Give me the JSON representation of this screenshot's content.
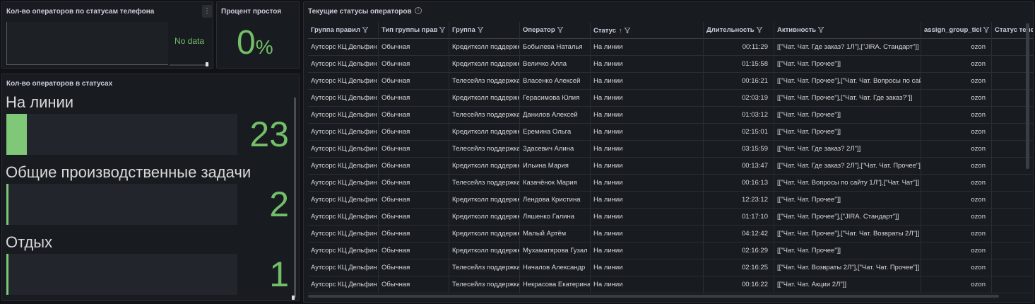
{
  "phone_panel": {
    "title": "Кол-во операторов по статусам телефона",
    "menu_glyph": "⋮",
    "no_data": "No data"
  },
  "idle_panel": {
    "title": "Процент простоя",
    "value": "0",
    "unit": "%"
  },
  "status_count_panel": {
    "title": "Кол-во операторов в статусах",
    "items": [
      {
        "label": "На линии",
        "value": "23",
        "fill_fraction": 0.09
      },
      {
        "label": "Общие производственные задачи",
        "value": "2",
        "fill_fraction": 0.01
      },
      {
        "label": "Отдых",
        "value": "1",
        "fill_fraction": 0.005
      }
    ],
    "color": "#73bf69"
  },
  "table_panel": {
    "title": "Текущие статусы операторов",
    "info_glyph": "i",
    "columns": [
      "Группа правил",
      "Тип группы прав",
      "Группа",
      "Оператор",
      "Статус",
      "Длительность",
      "Активность",
      "assign_group_ticl",
      "Статус теле"
    ],
    "sort_arrow": "↑",
    "rows": [
      [
        "Аутсорс КЦ Дельфин",
        "Обычная",
        "Кредитколл поддержка",
        "Бобылева Наталья",
        "На линии",
        "00:11:29",
        "[[\"Чат. Чат. Где заказ? 1Л\"],[\"JIRA. Стандарт\"]]",
        "ozon",
        ""
      ],
      [
        "Аутсорс КЦ Дельфин",
        "Обычная",
        "Кредитколл поддержка",
        "Величко Алла",
        "На линии",
        "01:15:58",
        "[[\"Чат. Чат. Прочее\"]]",
        "ozon",
        ""
      ],
      [
        "Аутсорс КЦ Дельфин",
        "Обычная",
        "Телесейлз поддержка",
        "Власенко Алексей",
        "На линии",
        "00:16:21",
        "[[\"Чат. Чат. Прочее\"],[\"Чат. Чат. Вопросы по сайту\"]]",
        "ozon",
        ""
      ],
      [
        "Аутсорс КЦ Дельфин",
        "Обычная",
        "Кредитколл поддержка",
        "Герасимова Юлия",
        "На линии",
        "02:03:19",
        "[[\"Чат. Чат. Прочее\"],[\"Чат. Чат. Где заказ?\"]]",
        "ozon",
        ""
      ],
      [
        "Аутсорс КЦ Дельфин",
        "Обычная",
        "Телесейлз поддержка",
        "Данилов Алексей",
        "На линии",
        "01:03:12",
        "[[\"Чат. Чат. Прочее\"]]",
        "ozon",
        ""
      ],
      [
        "Аутсорс КЦ Дельфин",
        "Обычная",
        "Кредитколл поддержка",
        "Еремина Ольга",
        "На линии",
        "02:15:01",
        "[[\"Чат. Чат. Прочее\"]]",
        "ozon",
        ""
      ],
      [
        "Аутсорс КЦ Дельфин",
        "Обычная",
        "Телесейлз поддержка",
        "Здасевич Алина",
        "На линии",
        "03:15:59",
        "[[\"Чат. Чат. Где заказ? 2Л\"]]",
        "ozon",
        ""
      ],
      [
        "Аутсорс КЦ Дельфин",
        "Обычная",
        "Кредитколл поддержка",
        "Ильина Мария",
        "На линии",
        "00:13:47",
        "[[\"Чат. Чат. Где заказ? 2Л\"],[\"Чат. Чат. Прочее\"]]",
        "ozon",
        ""
      ],
      [
        "Аутсорс КЦ Дельфин",
        "Обычная",
        "Телесейлз поддержка",
        "Казачёнок Мария",
        "На линии",
        "00:16:13",
        "[[\"Чат. Чат. Вопросы по сайту 1Л\"],[\"Чат. Чат\"]]",
        "ozon",
        ""
      ],
      [
        "Аутсорс КЦ Дельфин",
        "Обычная",
        "Кредитколл поддержка",
        "Лендова Кристина",
        "На линии",
        "12:23:12",
        "[[\"Чат. Чат. Прочее\"]]",
        "ozon",
        ""
      ],
      [
        "Аутсорс КЦ Дельфин",
        "Обычная",
        "Кредитколл поддержка",
        "Ляшенко Галина",
        "На линии",
        "01:17:10",
        "[[\"Чат. Чат. Прочее\"],[\"JIRA. Стандарт\"]]",
        "ozon",
        ""
      ],
      [
        "Аутсорс КЦ Дельфин",
        "Обычная",
        "Кредитколл поддержка",
        "Малый Артём",
        "На линии",
        "04:12:42",
        "[[\"Чат. Чат. Прочее\"],[\"Чат. Чат. Возвраты 2Л\"]]",
        "ozon",
        ""
      ],
      [
        "Аутсорс КЦ Дельфин",
        "Обычная",
        "Кредитколл поддержка",
        "Мухаматярова Гузал",
        "На линии",
        "02:16:29",
        "[[\"Чат. Чат. Прочее\"]]",
        "ozon",
        ""
      ],
      [
        "Аутсорс КЦ Дельфин",
        "Обычная",
        "Телесейлз поддержка",
        "Началов Александр",
        "На линии",
        "02:16:25",
        "[[\"Чат. Чат. Возвраты 2Л\"],[\"Чат. Чат. Прочее\"]]",
        "ozon",
        ""
      ],
      [
        "Аутсорс КЦ Дельфин",
        "Обычная",
        "Телесейлз поддержка",
        "Некрасова Екатерина",
        "На линии",
        "00:16:22",
        "[[\"Чат. Чат. Акции 2Л\"]]",
        "ozon",
        ""
      ]
    ]
  }
}
